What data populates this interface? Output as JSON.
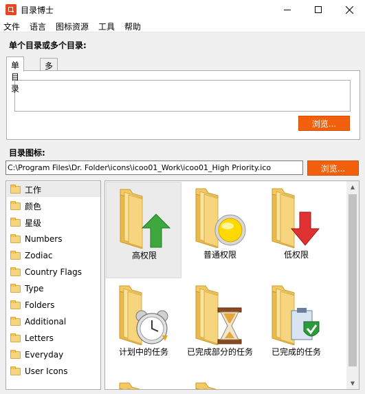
{
  "window": {
    "title": "目录博士"
  },
  "menu": [
    "文件",
    "语言",
    "图标资源",
    "工具",
    "帮助"
  ],
  "dirs_section": {
    "label": "单个目录或多个目录:",
    "tabs": [
      "单目录",
      "多目录"
    ],
    "active_tab": "单目录",
    "textarea_value": "",
    "browse_label": "浏览..."
  },
  "icon_section": {
    "label": "目录图标:",
    "path_value": "C:\\Program Files\\Dr. Folder\\icons\\icoo01_Work\\icoo01_High Priority.ico",
    "browse_label": "浏览..."
  },
  "categories": [
    {
      "label": "工作",
      "selected": true
    },
    {
      "label": "颜色",
      "selected": false
    },
    {
      "label": "星级",
      "selected": false
    },
    {
      "label": "Numbers",
      "selected": false
    },
    {
      "label": "Zodiac",
      "selected": false
    },
    {
      "label": "Country Flags",
      "selected": false
    },
    {
      "label": "Type",
      "selected": false
    },
    {
      "label": "Folders",
      "selected": false
    },
    {
      "label": "Additional",
      "selected": false
    },
    {
      "label": "Letters",
      "selected": false
    },
    {
      "label": "Everyday",
      "selected": false
    },
    {
      "label": "User Icons",
      "selected": false
    }
  ],
  "icons": [
    {
      "label": "高权限",
      "overlay": "green-up-arrow",
      "selected": true
    },
    {
      "label": "普通权限",
      "overlay": "yellow-circle",
      "selected": false
    },
    {
      "label": "低权限",
      "overlay": "red-down-arrow",
      "selected": false
    },
    {
      "label": "计划中的任务",
      "overlay": "alarm-clock",
      "selected": false
    },
    {
      "label": "已完成部分的任务",
      "overlay": "hourglass",
      "selected": false
    },
    {
      "label": "已完成的任务",
      "overlay": "clipboard-check",
      "selected": false
    }
  ],
  "colors": {
    "accent": "#f2600e",
    "folder_yellow": "#f7d57e",
    "selection": "#ebebeb"
  }
}
